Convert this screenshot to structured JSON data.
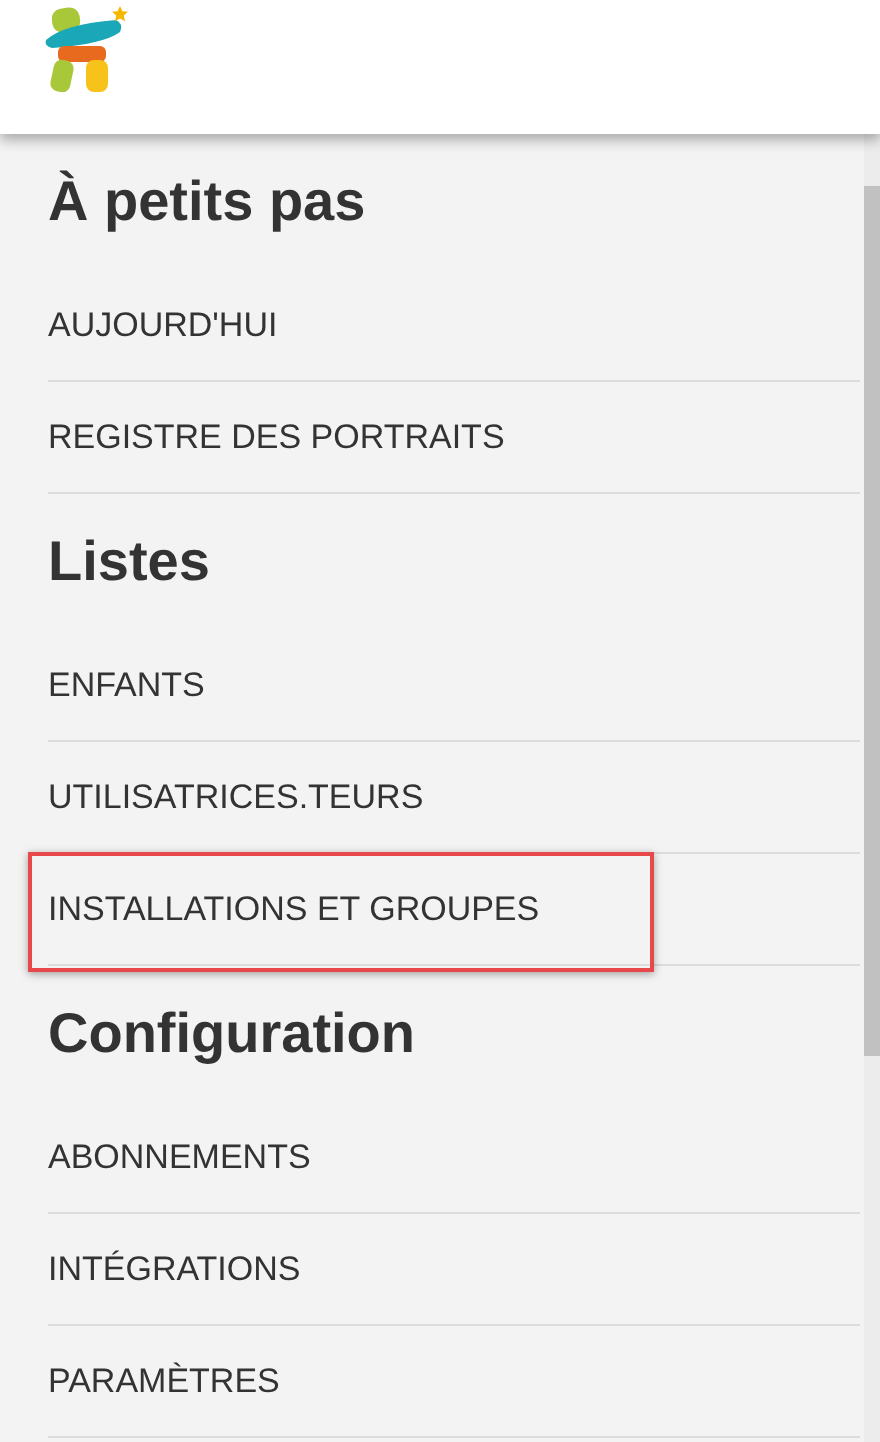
{
  "sections": [
    {
      "title": "À petits pas",
      "items": [
        {
          "label": "AUJOURD'HUI",
          "highlighted": false
        },
        {
          "label": "REGISTRE DES PORTRAITS",
          "highlighted": false
        }
      ]
    },
    {
      "title": "Listes",
      "items": [
        {
          "label": "ENFANTS",
          "highlighted": false
        },
        {
          "label": "UTILISATRICES.TEURS",
          "highlighted": false
        },
        {
          "label": "INSTALLATIONS ET GROUPES",
          "highlighted": true
        }
      ]
    },
    {
      "title": "Configuration",
      "items": [
        {
          "label": "ABONNEMENTS",
          "highlighted": false
        },
        {
          "label": "INTÉGRATIONS",
          "highlighted": false
        },
        {
          "label": "PARAMÈTRES",
          "highlighted": false
        }
      ]
    }
  ]
}
